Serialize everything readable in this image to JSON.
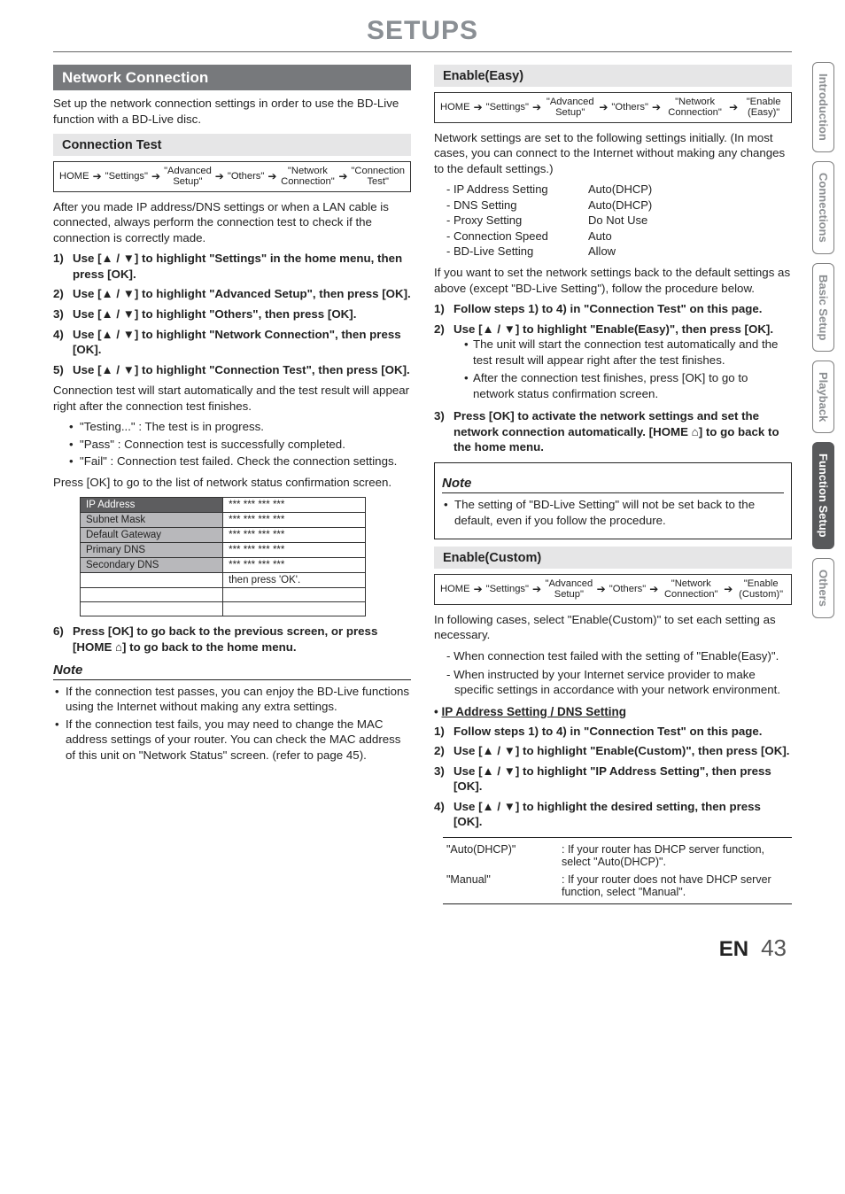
{
  "page": {
    "title": "SETUPS",
    "lang": "EN",
    "number": "43"
  },
  "tabs": [
    "Introduction",
    "Connections",
    "Basic Setup",
    "Playback",
    "Function Setup",
    "Others"
  ],
  "active_tab_index": 4,
  "left": {
    "section": "Network Connection",
    "intro": "Set up the network connection settings in order to use the BD-Live function with a BD-Live disc.",
    "sub1": "Connection Test",
    "bc1": [
      "HOME",
      "\"Settings\"",
      "\"Advanced Setup\"",
      "\"Others\"",
      "\"Network Connection\"",
      "\"Connection Test\""
    ],
    "after_bc": "After you made IP address/DNS settings or when a LAN cable is connected, always perform the connection test to check if the connection is correctly made.",
    "steps": [
      "Use [▲ / ▼] to highlight \"Settings\" in the home menu, then press [OK].",
      "Use [▲ / ▼] to highlight \"Advanced Setup\", then press [OK].",
      "Use [▲ / ▼] to highlight \"Others\", then press [OK].",
      "Use [▲ / ▼] to highlight \"Network Connection\", then press [OK].",
      "Use [▲ / ▼] to highlight \"Connection Test\", then press [OK]."
    ],
    "after_steps": "Connection test will start automatically and the test result will appear right after the connection test finishes.",
    "bullets": [
      "\"Testing...\" : The test is in progress.",
      "\"Pass\" : Connection test is successfully completed.",
      "\"Fail\" : Connection test failed. Check the connection settings."
    ],
    "press_ok": " Press [OK] to go to the list of network status confirmation screen.",
    "status_rows": [
      {
        "k": "IP Address",
        "v": "*** *** *** ***"
      },
      {
        "k": "Subnet Mask",
        "v": "*** *** *** ***"
      },
      {
        "k": "Default Gateway",
        "v": "*** *** *** ***"
      },
      {
        "k": "Primary DNS",
        "v": "*** *** *** ***"
      },
      {
        "k": "Secondary DNS",
        "v": "*** *** *** ***"
      }
    ],
    "status_footer": "then press 'OK'.",
    "step6": "Press [OK] to go back to the previous screen, or press [HOME ⌂] to go back to the home menu.",
    "note_head": "Note",
    "notes": [
      "If the connection test passes, you can enjoy the BD-Live functions using the Internet without making any extra settings.",
      "If the connection test fails, you may need to change the MAC address settings of your router. You can check the MAC address of this unit on \"Network Status\" screen. (refer to page 45)."
    ]
  },
  "right": {
    "sub1": "Enable(Easy)",
    "bc1": [
      "HOME",
      "\"Settings\"",
      "\"Advanced Setup\"",
      "\"Others\"",
      "\"Network Connection\"",
      "\"Enable (Easy)\""
    ],
    "para1": "Network settings are set to the following settings initially. (In most cases, you can connect to the Internet without making any changes to the default settings.)",
    "defaults": [
      {
        "k": "- IP Address Setting",
        "v": "Auto(DHCP)"
      },
      {
        "k": "- DNS Setting",
        "v": "Auto(DHCP)"
      },
      {
        "k": "- Proxy Setting",
        "v": "Do Not Use"
      },
      {
        "k": "- Connection Speed",
        "v": "Auto"
      },
      {
        "k": "- BD-Live Setting",
        "v": "Allow"
      }
    ],
    "para2": "If you want to set the network settings back to the default settings as above (except \"BD-Live Setting\"), follow the procedure below.",
    "easy_steps": [
      {
        "main": "Follow steps 1) to 4) in \"Connection Test\" on this page."
      },
      {
        "main": "Use [▲ / ▼] to highlight \"Enable(Easy)\", then press [OK].",
        "sub": [
          "The unit will start the connection test automatically and the test result will appear right after the test finishes.",
          "After the connection test finishes, press [OK] to go to network status confirmation screen."
        ]
      },
      {
        "main": "Press [OK] to activate the network settings and set the network connection automatically. [HOME ⌂] to go back to the home menu."
      }
    ],
    "note_head": "Note",
    "note_body": "The setting of \"BD-Live Setting\" will not be set back to the default, even if you follow the procedure.",
    "sub2": "Enable(Custom)",
    "bc2": [
      "HOME",
      "\"Settings\"",
      "\"Advanced Setup\"",
      "\"Others\"",
      "\"Network Connection\"",
      "\"Enable (Custom)\""
    ],
    "custom_para": "In following cases, select \"Enable(Custom)\" to set each setting as necessary.",
    "custom_dashes": [
      "- When connection test failed with the setting of \"Enable(Easy)\".",
      "- When instructed by your Internet service provider to make specific settings in accordance with your network environment."
    ],
    "ipdns_head": "IP Address Setting / DNS Setting",
    "custom_steps": [
      "Follow steps 1) to 4) in \"Connection Test\" on this page.",
      "Use [▲ / ▼] to highlight \"Enable(Custom)\", then press [OK].",
      "Use [▲ / ▼] to highlight \"IP Address Setting\", then press [OK].",
      "Use [▲ / ▼] to highlight the desired setting, then press [OK]."
    ],
    "choices": [
      {
        "k": "\"Auto(DHCP)\"",
        "v": ": If your router has DHCP server function, select \"Auto(DHCP)\"."
      },
      {
        "k": "\"Manual\"",
        "v": ": If your router does not have DHCP server function, select \"Manual\"."
      }
    ]
  }
}
